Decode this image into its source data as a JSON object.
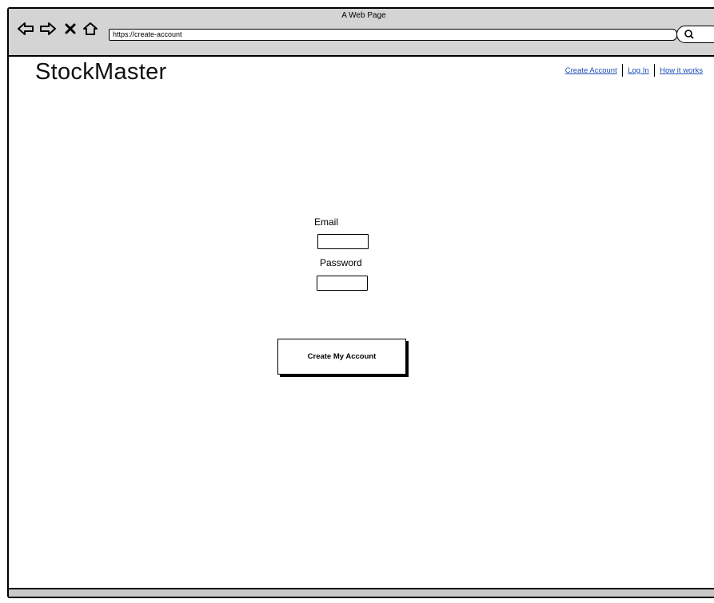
{
  "browser": {
    "window_title": "A Web Page",
    "url": "https://create-account"
  },
  "header": {
    "brand": "StockMaster",
    "nav_links": [
      {
        "label": "Create Account"
      },
      {
        "label": "Log In"
      },
      {
        "label": "How it works"
      }
    ]
  },
  "form": {
    "email_label": "Email",
    "password_label": "Password",
    "submit_label": "Create My Account"
  },
  "colors": {
    "link": "#1a4fb8",
    "chrome": "#d4d4d4"
  },
  "icons": [
    "back-arrow-icon",
    "forward-arrow-icon",
    "stop-icon",
    "home-icon",
    "search-icon"
  ]
}
